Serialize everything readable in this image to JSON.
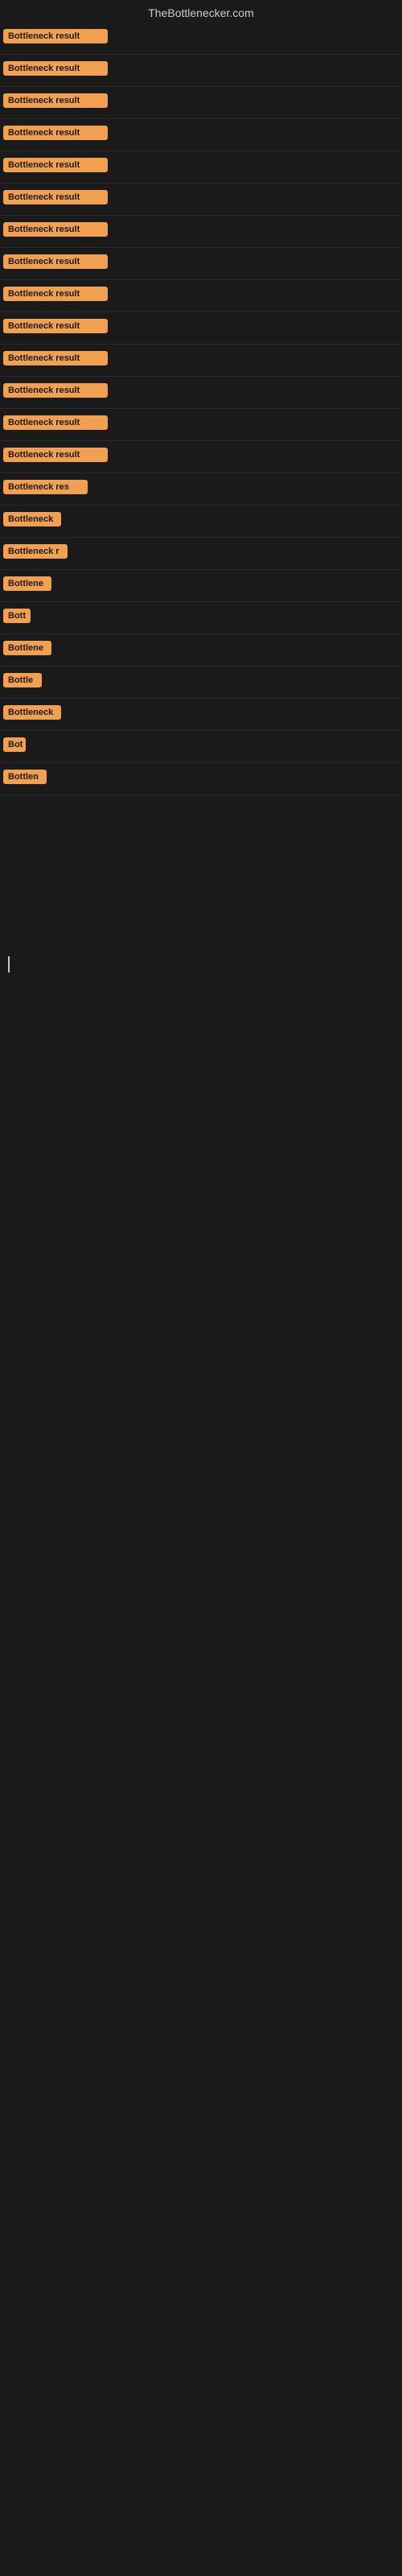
{
  "site": {
    "title": "TheBottlenecker.com"
  },
  "results": [
    {
      "label": "Bottleneck result",
      "width": 130
    },
    {
      "label": "Bottleneck result",
      "width": 130
    },
    {
      "label": "Bottleneck result",
      "width": 130
    },
    {
      "label": "Bottleneck result",
      "width": 130
    },
    {
      "label": "Bottleneck result",
      "width": 130
    },
    {
      "label": "Bottleneck result",
      "width": 130
    },
    {
      "label": "Bottleneck result",
      "width": 130
    },
    {
      "label": "Bottleneck result",
      "width": 130
    },
    {
      "label": "Bottleneck result",
      "width": 130
    },
    {
      "label": "Bottleneck result",
      "width": 130
    },
    {
      "label": "Bottleneck result",
      "width": 130
    },
    {
      "label": "Bottleneck result",
      "width": 130
    },
    {
      "label": "Bottleneck result",
      "width": 130
    },
    {
      "label": "Bottleneck result",
      "width": 130
    },
    {
      "label": "Bottleneck res",
      "width": 105
    },
    {
      "label": "Bottleneck",
      "width": 72
    },
    {
      "label": "Bottleneck r",
      "width": 80
    },
    {
      "label": "Bottlene",
      "width": 60
    },
    {
      "label": "Bott",
      "width": 34
    },
    {
      "label": "Bottlene",
      "width": 60
    },
    {
      "label": "Bottle",
      "width": 48
    },
    {
      "label": "Bottleneck",
      "width": 72
    },
    {
      "label": "Bot",
      "width": 28
    },
    {
      "label": "Bottlen",
      "width": 54
    }
  ]
}
